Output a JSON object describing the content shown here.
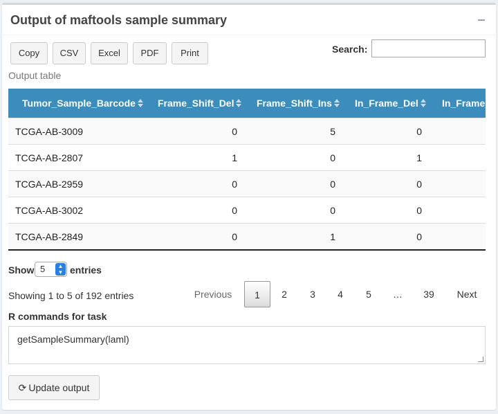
{
  "header": {
    "title": "Output of maftools sample summary",
    "collapse_label": "−"
  },
  "toolbar": {
    "buttons": [
      "Copy",
      "CSV",
      "Excel",
      "PDF",
      "Print"
    ]
  },
  "search": {
    "label": "Search:",
    "value": "",
    "placeholder": ""
  },
  "table": {
    "caption": "Output table",
    "columns": [
      "Tumor_Sample_Barcode",
      "Frame_Shift_Del",
      "Frame_Shift_Ins",
      "In_Frame_Del",
      "In_Frame_"
    ],
    "rows": [
      [
        "TCGA-AB-3009",
        "0",
        "5",
        "0"
      ],
      [
        "TCGA-AB-2807",
        "1",
        "0",
        "1"
      ],
      [
        "TCGA-AB-2959",
        "0",
        "0",
        "0"
      ],
      [
        "TCGA-AB-3002",
        "0",
        "0",
        "0"
      ],
      [
        "TCGA-AB-2849",
        "0",
        "1",
        "0"
      ]
    ],
    "horizontal_scroll_fraction": 0.56
  },
  "length": {
    "show_label": "Show",
    "value": "5",
    "entries_label": "entries"
  },
  "info": "Showing 1 to 5 of 192 entries",
  "pagination": {
    "previous": "Previous",
    "pages": [
      "1",
      "2",
      "3",
      "4",
      "5",
      "…",
      "39"
    ],
    "current": "1",
    "next": "Next"
  },
  "commands": {
    "label": "R commands for task",
    "code": "getSampleSummary(laml)"
  },
  "update": {
    "icon": "refresh-icon",
    "label": "Update output"
  },
  "colors": {
    "header_bg": "#3c8dbc",
    "box_border": "#d2d6de",
    "page_bg": "#ecf0f5"
  }
}
